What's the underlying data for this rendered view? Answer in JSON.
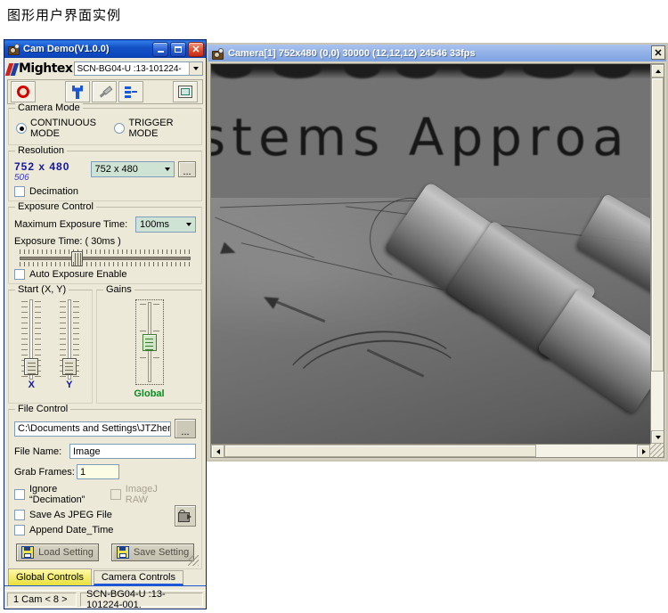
{
  "page": {
    "heading": "图形用户界面实例"
  },
  "cam_demo": {
    "title": "Cam Demo(V1.0.0)",
    "window_buttons": {
      "minimize": "minimize",
      "maximize": "maximize",
      "close": "✕"
    },
    "brand": "Mightex",
    "camera_select_value": "SCN-BG04-U  :13-101224-",
    "toolbar": {
      "record": "record-button",
      "settings": "settings-button",
      "calibrate": "calibrate-button",
      "connect": "connect-button",
      "display": "display-button"
    },
    "camera_mode": {
      "legend": "Camera Mode",
      "options": [
        "CONTINUOUS MODE",
        "TRIGGER MODE"
      ],
      "selected": "CONTINUOUS MODE"
    },
    "resolution": {
      "legend": "Resolution",
      "value_big": "752  x  480",
      "value_sub": "506",
      "combo_value": "752 x 480",
      "browse_label": "...",
      "decimation_label": "Decimation",
      "decimation_checked": false
    },
    "exposure": {
      "legend": "Exposure Control",
      "max_label": "Maximum  Exposure Time:",
      "max_value": "100ms",
      "time_label": "Exposure Time: ( 30ms )",
      "slider_percent": 30,
      "auto_label": "Auto Exposure Enable",
      "auto_checked": false
    },
    "start_xy": {
      "legend": "Start (X, Y)",
      "x_label": "X",
      "y_label": "Y",
      "x_percent": 95,
      "y_percent": 95
    },
    "gains": {
      "legend": "Gains",
      "global_label": "Global",
      "global_percent": 48
    },
    "file_control": {
      "legend": "File Control",
      "path_value": "C:\\Documents and Settings\\JTZheng\\",
      "path_browse_label": "...",
      "file_name_label": "File Name:",
      "file_name_value": "Image",
      "grab_frames_label": "Grab Frames:",
      "grab_frames_value": "1",
      "ignore_decimation_label": "Ignore “Decimation”",
      "ignore_decimation_checked": false,
      "imagej_raw_label": "ImageJ RAW",
      "imagej_raw_checked": false,
      "save_jpeg_label": "Save As JPEG File",
      "save_jpeg_checked": false,
      "append_date_label": "Append Date_Time",
      "append_date_checked": false,
      "capture_button": "capture-button"
    },
    "buttons": {
      "load_setting": "Load Setting",
      "save_setting": "Save Setting"
    },
    "tabs": [
      {
        "label": "Global Controls",
        "active": true
      },
      {
        "label": "Camera Controls",
        "active": false
      }
    ],
    "status": {
      "cam_count": "1 Cam < 8 >",
      "cam_id": "SCN-BG04-U   :13-101224-001."
    }
  },
  "camera_window": {
    "title": "Camera[1]   752x480 (0,0) 30000 (12,12,12) 24546 33fps",
    "close_label": "✕",
    "image_text": "stems Approa"
  },
  "colors": {
    "xp_title_blue": "#0d47bd",
    "cam_title_blue": "#93b2e8",
    "panel_face": "#ece9d8",
    "combo_green": "#cfe3d4",
    "accent_blue": "#16169c",
    "accent_green": "#0b8a23",
    "tab_active_yellow": "#e8e03a",
    "record_red": "#d40000"
  }
}
